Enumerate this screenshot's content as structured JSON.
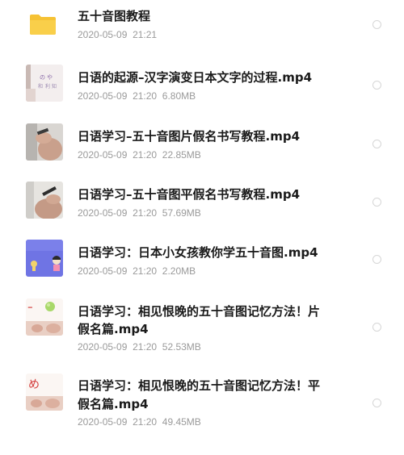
{
  "items": [
    {
      "name": "五十音图教程",
      "name_line2": "",
      "date": "2020-05-09",
      "time": "21:21",
      "size": "",
      "type": "folder",
      "thumb_icon": "folder-icon"
    },
    {
      "name": "日语的起源–汉字演变日本文字的过程.mp4",
      "name_line2": "",
      "date": "2020-05-09",
      "time": "21:20",
      "size": "6.80MB",
      "type": "video",
      "thumb_icon": "video-thumbnail"
    },
    {
      "name": "日语学习–五十音图片假名书写教程.mp4",
      "name_line2": "",
      "date": "2020-05-09",
      "time": "21:20",
      "size": "22.85MB",
      "type": "video",
      "thumb_icon": "video-thumbnail"
    },
    {
      "name": "日语学习–五十音图平假名书写教程.mp4",
      "name_line2": "",
      "date": "2020-05-09",
      "time": "21:20",
      "size": "57.69MB",
      "type": "video",
      "thumb_icon": "video-thumbnail"
    },
    {
      "name": "日语学习：日本小女孩教你学五十音图.mp4",
      "name_line2": "",
      "date": "2020-05-09",
      "time": "21:20",
      "size": "2.20MB",
      "type": "video",
      "thumb_icon": "video-thumbnail"
    },
    {
      "name": "日语学习：相见恨晚的五十音图记忆方法！片",
      "name_line2": "假名篇.mp4",
      "date": "2020-05-09",
      "time": "21:20",
      "size": "52.53MB",
      "type": "video",
      "thumb_icon": "video-thumbnail"
    },
    {
      "name": "日语学习：相见恨晚的五十音图记忆方法！平",
      "name_line2": "假名篇.mp4",
      "date": "2020-05-09",
      "time": "21:20",
      "size": "49.45MB",
      "type": "video",
      "thumb_icon": "video-thumbnail"
    }
  ],
  "colors": {
    "folder": "#f6c234",
    "name_text": "#1a1a1a",
    "meta_text": "#9a9a9a",
    "radio_border": "#d6d6d6"
  }
}
